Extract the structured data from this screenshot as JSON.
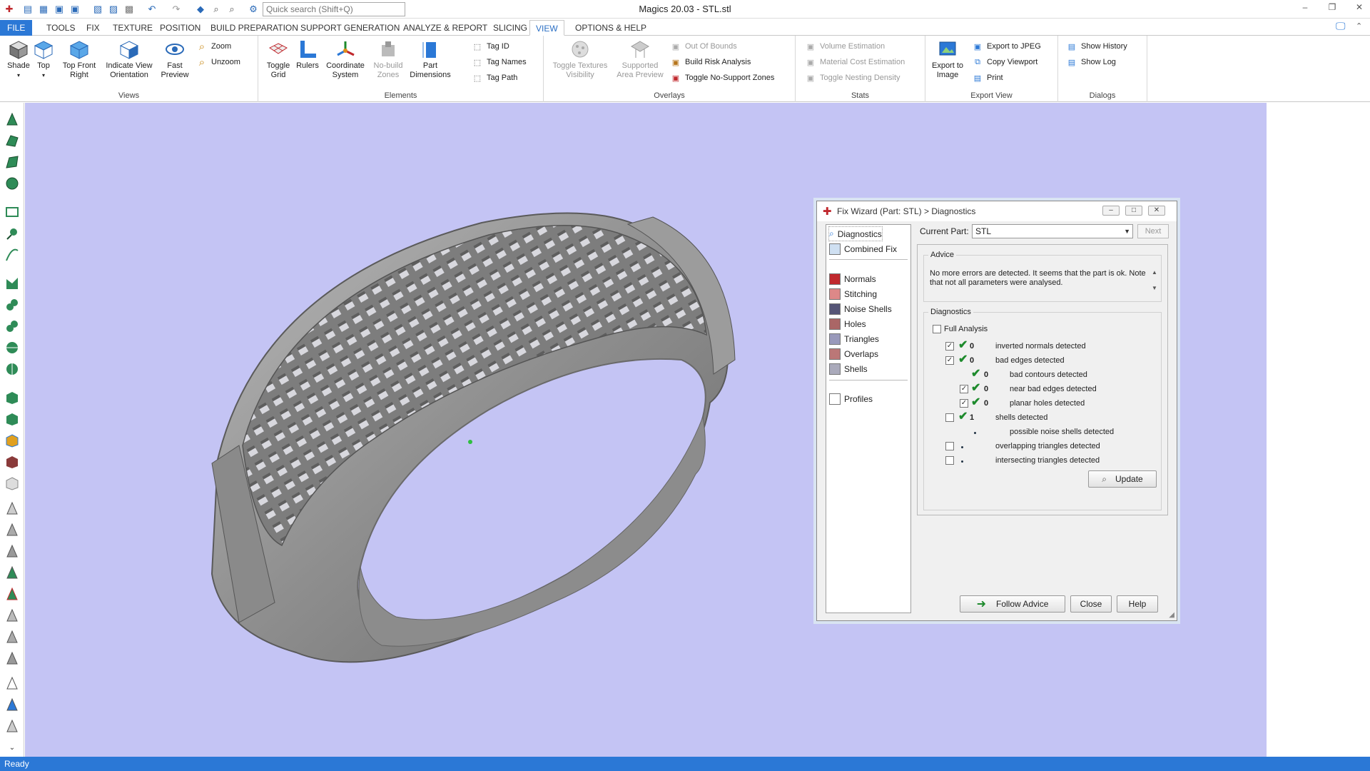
{
  "window": {
    "title": "Magics 20.03 - STL.stl"
  },
  "search": {
    "placeholder": "Quick search (Shift+Q)"
  },
  "tabs": [
    "FILE",
    "TOOLS",
    "FIX",
    "TEXTURE",
    "POSITION",
    "BUILD PREPARATION",
    "SUPPORT GENERATION",
    "ANALYZE & REPORT",
    "SLICING",
    "VIEW",
    "OPTIONS & HELP"
  ],
  "ribbon": {
    "views": {
      "label": "Views",
      "shade": "Shade",
      "top": "Top",
      "top_front_right": "Top Front Right",
      "indicate": "Indicate View Orientation",
      "fast_preview": "Fast Preview",
      "zoom": "Zoom",
      "unzoom": "Unzoom"
    },
    "elements": {
      "label": "Elements",
      "toggle_grid": "Toggle Grid",
      "rulers": "Rulers",
      "coord": "Coordinate System",
      "nobuild": "No-build Zones",
      "part_dim": "Part Dimensions",
      "tag_id": "Tag ID",
      "tag_names": "Tag Names",
      "tag_path": "Tag Path"
    },
    "overlays": {
      "label": "Overlays",
      "toggle_tex": "Toggle Textures Visibility",
      "supported": "Supported Area Preview",
      "out_of_bounds": "Out Of Bounds",
      "build_risk": "Build Risk Analysis",
      "no_support": "Toggle No-Support Zones"
    },
    "stats": {
      "label": "Stats",
      "volume": "Volume Estimation",
      "material": "Material Cost Estimation",
      "nesting": "Toggle Nesting Density"
    },
    "export": {
      "label": "Export View",
      "export_image": "Export to Image",
      "export_jpeg": "Export to JPEG",
      "copy_viewport": "Copy Viewport",
      "print": "Print"
    },
    "dialogs": {
      "label": "Dialogs",
      "history": "Show History",
      "log": "Show Log"
    }
  },
  "status": "Ready",
  "dialog": {
    "title": "Fix Wizard (Part: STL) > Diagnostics",
    "nav": [
      "Diagnostics",
      "Combined Fix",
      "Normals",
      "Stitching",
      "Noise Shells",
      "Holes",
      "Triangles",
      "Overlaps",
      "Shells",
      "Profiles"
    ],
    "current_part_label": "Current Part:",
    "current_part": "STL",
    "next": "Next",
    "advice_label": "Advice",
    "advice_text": "No more errors are detected. It seems that the part is ok. Note that not all parameters were analysed.",
    "diagnostics_label": "Diagnostics",
    "full_analysis": "Full Analysis",
    "rows": [
      {
        "count": "0",
        "text": "inverted normals detected",
        "checked": true
      },
      {
        "count": "0",
        "text": "bad edges detected",
        "checked": true
      },
      {
        "count": "0",
        "text": "bad contours detected",
        "checked": false
      },
      {
        "count": "0",
        "text": "near bad edges detected",
        "checked": true
      },
      {
        "count": "0",
        "text": "planar holes detected",
        "checked": true
      },
      {
        "count": "1",
        "text": "shells detected",
        "checked": false
      },
      {
        "count": "",
        "text": "possible noise shells detected",
        "checked": false
      },
      {
        "count": "",
        "text": "overlapping triangles detected",
        "checked": false
      },
      {
        "count": "",
        "text": "intersecting triangles detected",
        "checked": false
      }
    ],
    "update": "Update",
    "follow_advice": "Follow Advice",
    "close": "Close",
    "help": "Help"
  },
  "colors": {
    "accent": "#2b78d6",
    "viewport": "#c4c4f4",
    "model": "#9a9a9a",
    "check": "#1d8a2c"
  }
}
